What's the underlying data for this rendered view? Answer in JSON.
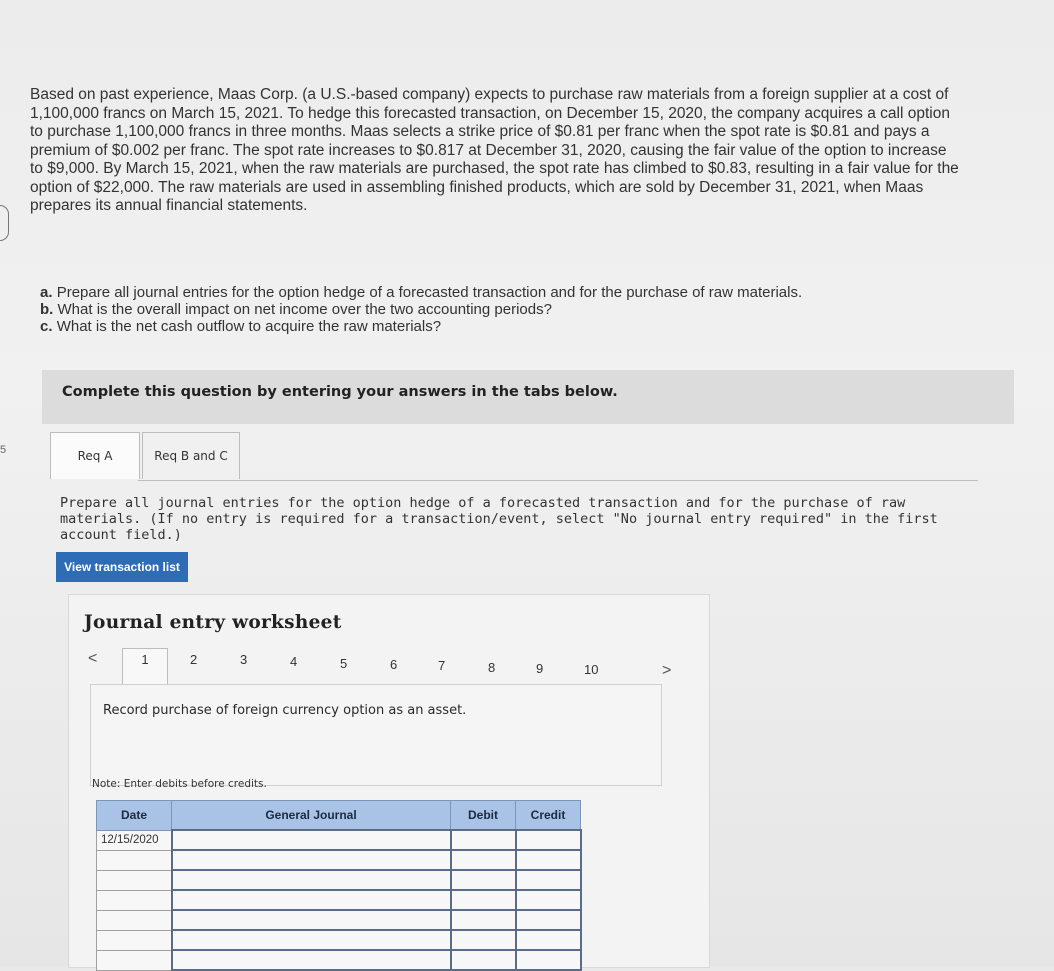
{
  "problem": {
    "lines": [
      "Based on past experience, Maas Corp. (a U.S.-based company) expects to purchase raw materials from a foreign supplier at a cost of",
      "1,100,000 francs on March 15, 2021. To hedge this forecasted transaction, on December 15, 2020, the company acquires a call option",
      "to purchase 1,100,000 francs in three months. Maas selects a strike price of $0.81 per franc when the spot rate is $0.81 and pays a",
      "premium of $0.002 per franc. The spot rate increases to $0.817 at December 31, 2020, causing the fair value of the option to increase",
      "to $9,000. By March 15, 2021, when the raw materials are purchased, the spot rate has climbed to $0.83, resulting in a fair value for the",
      "option of $22,000. The raw materials are used in assembling finished products, which are sold by December 31, 2021, when Maas",
      "prepares its annual financial statements."
    ]
  },
  "requirements": [
    {
      "letter": "a.",
      "text": "Prepare all journal entries for the option hedge of a forecasted transaction and for the purchase of raw materials."
    },
    {
      "letter": "b.",
      "text": "What is the overall impact on net income over the two accounting periods?"
    },
    {
      "letter": "c.",
      "text": "What is the net cash outflow to acquire the raw materials?"
    }
  ],
  "banner": "Complete this question by entering your answers in the tabs below.",
  "tabs": [
    {
      "label": "Req A"
    },
    {
      "label": "Req B and C"
    }
  ],
  "instruction": "Prepare all journal entries for the option hedge of a forecasted transaction and for the purchase of raw materials. (If no entry is required for a transaction/event, select \"No journal entry required\" in the first account field.)",
  "view_button": "View transaction list",
  "worksheet": {
    "title": "Journal entry worksheet",
    "prev": "<",
    "next": ">",
    "pages": [
      "1",
      "2",
      "3",
      "4",
      "5",
      "6",
      "7",
      "8",
      "9",
      "10"
    ],
    "description": "Record purchase of foreign currency option as an asset.",
    "note": "Note: Enter debits before credits.",
    "headers": {
      "date": "Date",
      "account": "General Journal",
      "debit": "Debit",
      "credit": "Credit"
    },
    "rows": [
      {
        "date": "12/15/2020",
        "account": "",
        "debit": "",
        "credit": ""
      },
      {
        "date": "",
        "account": "",
        "debit": "",
        "credit": ""
      },
      {
        "date": "",
        "account": "",
        "debit": "",
        "credit": ""
      },
      {
        "date": "",
        "account": "",
        "debit": "",
        "credit": ""
      },
      {
        "date": "",
        "account": "",
        "debit": "",
        "credit": ""
      },
      {
        "date": "",
        "account": "",
        "debit": "",
        "credit": ""
      },
      {
        "date": "",
        "account": "",
        "debit": "",
        "credit": ""
      }
    ]
  },
  "margin_mark": "5"
}
